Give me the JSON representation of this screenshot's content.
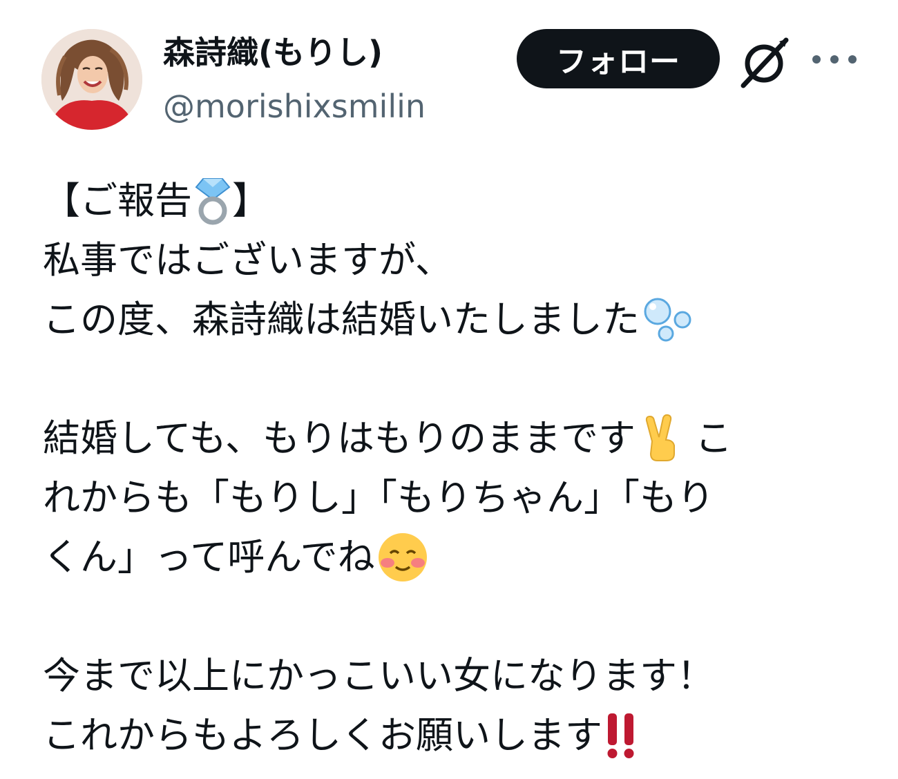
{
  "author": {
    "display_name": "森詩織(もりし)",
    "handle": "@morishixsmilin"
  },
  "actions": {
    "follow_label": "フォロー",
    "grok_icon": "grok-icon",
    "more_icon": "more-horizontal-icon"
  },
  "tweet": {
    "line1": "【ご報告",
    "line1_end": "】",
    "line2": "私事ではございますが、",
    "line3": "この度、森詩織は結婚いたしました",
    "line4": "結婚しても、もりはもりのままです",
    "line4_end": "こ",
    "line5": "れからも「もりし」「もりちゃん」「もり",
    "line6": "くん」って呼んでね",
    "line7": "今まで以上にかっこいい女になります！",
    "line8": "これからもよろしくお願いします"
  },
  "colors": {
    "text": "#0f1419",
    "secondary": "#536471",
    "follow_bg": "#0f1419",
    "follow_text": "#ffffff"
  }
}
